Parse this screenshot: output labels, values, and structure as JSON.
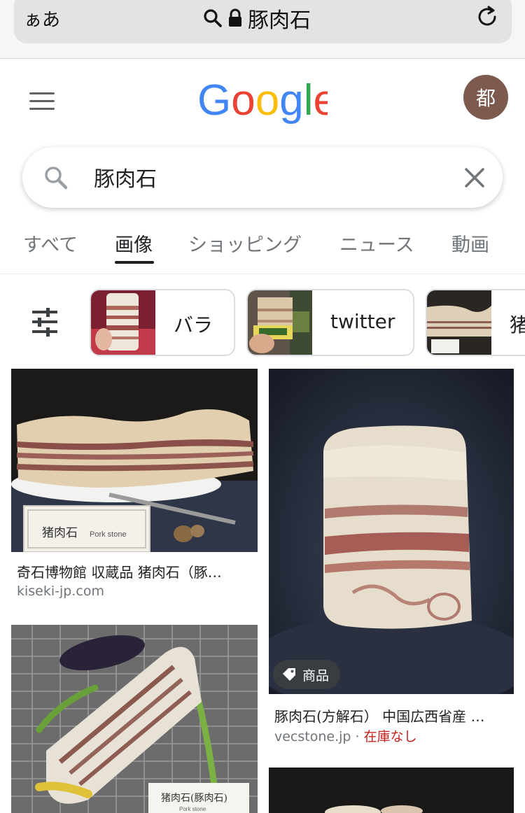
{
  "browser": {
    "aa_label": "ぁあ",
    "url_text": "豚肉石"
  },
  "header": {
    "logo_text": "Google",
    "avatar_letter": "都"
  },
  "search": {
    "query": "豚肉石"
  },
  "tabs": [
    {
      "label": "すべて",
      "active": false
    },
    {
      "label": "画像",
      "active": true
    },
    {
      "label": "ショッピング",
      "active": false
    },
    {
      "label": "ニュース",
      "active": false
    },
    {
      "label": "動画",
      "active": false
    }
  ],
  "chips": [
    {
      "label": "バラ"
    },
    {
      "label": "twitter"
    },
    {
      "label": "猪"
    }
  ],
  "results": [
    {
      "title": "奇石博物館 収蔵品 猪肉石（豚…",
      "source": "kiseki-jp.com",
      "plaque": "猪肉石",
      "plaque_en": "Pork stone"
    },
    {
      "title": "豚肉石(方解石） 中国広西省産 …",
      "source": "vecstone.jp",
      "source_sep": " · ",
      "stock": "在庫なし",
      "badge": "商品"
    },
    {
      "plaque": "猪肉石(豚肉石)",
      "plaque_en": "Pork stone"
    }
  ],
  "colors": {
    "google_blue": "#4285F4",
    "google_red": "#EA4335",
    "google_yellow": "#FBBC05",
    "google_green": "#34A853",
    "avatar_bg": "#7c5a4d",
    "stock_red": "#c5221f"
  }
}
